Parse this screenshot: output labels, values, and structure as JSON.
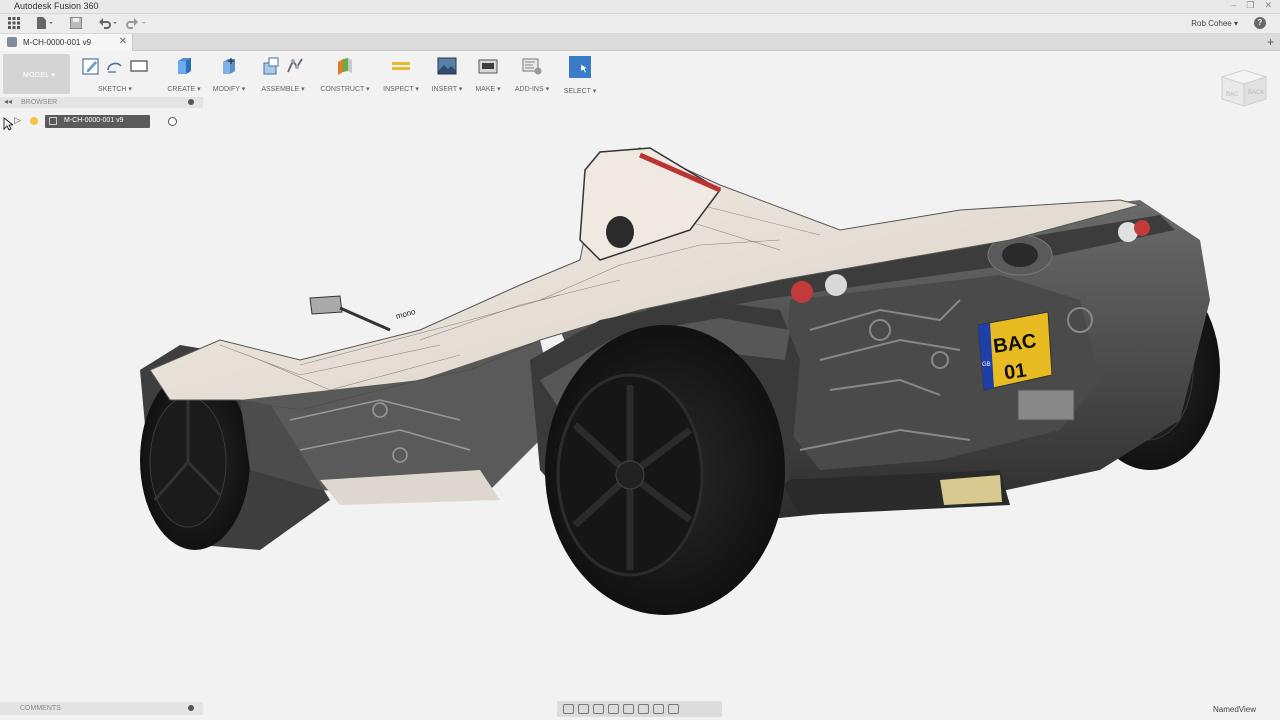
{
  "window": {
    "title": "Autodesk Fusion 360",
    "controls": [
      "–",
      "❐",
      "✕"
    ]
  },
  "quick_access": {
    "user": "Rob Cohee ▾",
    "help": "?"
  },
  "document_tab": {
    "label": "M-CH-0000-001 v9",
    "close": "✕",
    "add": "+"
  },
  "toolbar": {
    "workspace": "MODEL ▾",
    "groups": [
      {
        "label": "SKETCH ▾",
        "icons": [
          "sketch-icon",
          "arc-icon",
          "rectangle-icon"
        ]
      },
      {
        "label": "CREATE ▾",
        "icons": [
          "box-icon"
        ]
      },
      {
        "label": "MODIFY ▾",
        "icons": [
          "press-pull-icon"
        ]
      },
      {
        "label": "ASSEMBLE ▾",
        "icons": [
          "new-component-icon",
          "joint-icon"
        ]
      },
      {
        "label": "CONSTRUCT ▾",
        "icons": [
          "plane-icon"
        ]
      },
      {
        "label": "INSPECT ▾",
        "icons": [
          "measure-icon"
        ]
      },
      {
        "label": "INSERT ▾",
        "icons": [
          "image-icon"
        ]
      },
      {
        "label": "MAKE ▾",
        "icons": [
          "print-icon"
        ]
      },
      {
        "label": "ADD-INS ▾",
        "icons": [
          "scripts-icon"
        ]
      },
      {
        "label": "SELECT ▾",
        "icons": [
          "select-icon"
        ]
      }
    ]
  },
  "browser": {
    "title": "BROWSER",
    "root_node": "M-CH-0000-001 v9"
  },
  "comments": {
    "title": "COMMENTS"
  },
  "viewport": {
    "plate_line1": "BAC",
    "plate_line2": "01",
    "plate_country": "GB",
    "body_logo": "mono"
  },
  "viewcube": {
    "face_left": "BAC",
    "face_right": "BACK"
  },
  "status": {
    "named_view": "NamedView"
  },
  "colors": {
    "select_active": "#3a7cc8",
    "bulb": "#f5c242"
  }
}
